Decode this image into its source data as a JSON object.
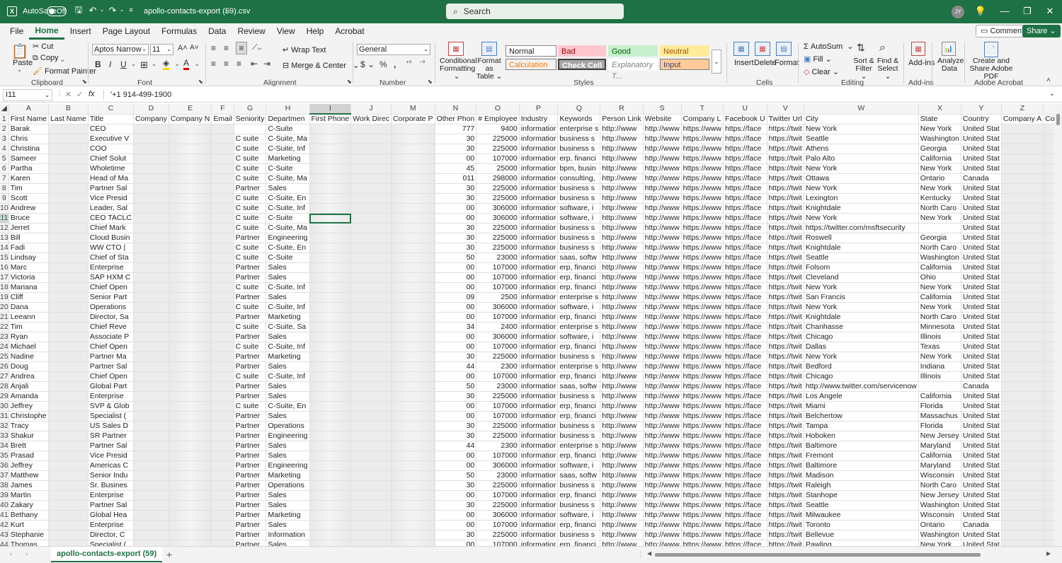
{
  "titlebar": {
    "autosave_label": "AutoSave",
    "autosave_state": "Off",
    "filename": "apollo-contacts-export (59).csv",
    "search_placeholder": "Search",
    "user_initials": "JY"
  },
  "menu": [
    "File",
    "Home",
    "Insert",
    "Page Layout",
    "Formulas",
    "Data",
    "Review",
    "View",
    "Help",
    "Acrobat"
  ],
  "menu_active": "Home",
  "menu_right": {
    "comments": "Comments",
    "share": "Share"
  },
  "ribbon": {
    "clipboard": {
      "paste": "Paste",
      "cut": "Cut",
      "copy": "Copy",
      "format_painter": "Format Painter",
      "group": "Clipboard"
    },
    "font": {
      "name": "Aptos Narrow",
      "size": "11",
      "group": "Font"
    },
    "alignment": {
      "wrap": "Wrap Text",
      "merge": "Merge & Center",
      "group": "Alignment"
    },
    "number": {
      "format": "General",
      "group": "Number"
    },
    "styles": {
      "conditional": "Conditional Formatting",
      "format_table": "Format as Table",
      "normal": "Normal",
      "bad": "Bad",
      "good": "Good",
      "neutral": "Neutral",
      "calculation": "Calculation",
      "check_cell": "Check Cell",
      "explanatory": "Explanatory T...",
      "input": "Input",
      "group": "Styles"
    },
    "cells": {
      "insert": "Insert",
      "delete": "Delete",
      "format": "Format",
      "group": "Cells"
    },
    "editing": {
      "autosum": "AutoSum",
      "fill": "Fill",
      "clear": "Clear",
      "sort": "Sort & Filter",
      "find": "Find & Select",
      "group": "Editing"
    },
    "addins": {
      "label": "Add-ins",
      "group": "Add-ins"
    },
    "analyze": {
      "label": "Analyze Data"
    },
    "acrobat": {
      "label": "Create and Share Adobe PDF",
      "group": "Adobe Acrobat"
    },
    "colors": {
      "normal": "#ffffff",
      "bad": "#ffc7ce",
      "good": "#c6efce",
      "neutral": "#ffeb9c",
      "calculation": "#f2f2f2",
      "check": "#a5a5a5",
      "input": "#ffcc99"
    }
  },
  "formula_bar": {
    "name_box": "I11",
    "fx": "fx",
    "value": "'+1 914-499-1900"
  },
  "columns": [
    "A",
    "B",
    "C",
    "D",
    "E",
    "F",
    "G",
    "H",
    "I",
    "J",
    "M",
    "N",
    "O",
    "P",
    "Q",
    "R",
    "S",
    "T",
    "U",
    "V",
    "W",
    "X",
    "Y",
    "Z",
    "AA",
    "AB",
    "AC",
    "AD",
    "AE",
    "AF",
    "AG"
  ],
  "headers": [
    "First Name",
    "Last Name",
    "Title",
    "Company",
    "Company N",
    "Email",
    "Seniority",
    "Departmen",
    "First Phone",
    "Work Direc",
    "Corporate P",
    "Other Phon",
    "# Employee",
    "Industry",
    "Keywords",
    "Person Link",
    "Website",
    "Company L",
    "Facebook U",
    "Twitter Url",
    "City",
    "State",
    "Country",
    "Company A",
    "Company C",
    "Company S",
    "Company C",
    "Company P",
    "SEO Descri",
    "Technologie",
    "Annual Rev"
  ],
  "rows": [
    [
      "Barak",
      "CEO",
      "",
      "777",
      "9400",
      "informatior",
      "enterprise s",
      "New York",
      "New York",
      "United Stat"
    ],
    [
      "Chris",
      "Executive V",
      "C suite",
      "30",
      "225000",
      "informatior",
      "business s",
      "Seattle",
      "Washington",
      "United Stat"
    ],
    [
      "Christina",
      "COO",
      "C suite",
      "30",
      "225000",
      "informatior",
      "business s",
      "Athens",
      "Georgia",
      "United Stat"
    ],
    [
      "Sameer",
      "Chief Solut",
      "C suite",
      "00",
      "107000",
      "informatior",
      "erp, financi",
      "Palo Alto",
      "California",
      "United Stat"
    ],
    [
      "Partha",
      "Wholetime",
      "C suite",
      "45",
      "25000",
      "informatior",
      "bpm, busin",
      "New York",
      "New York",
      "United Stat"
    ],
    [
      "Karen",
      "Head of Ma",
      "C suite",
      "011",
      "298000",
      "informatior",
      "consulting,",
      "Ottawa",
      "Ontario",
      "Canada"
    ],
    [
      "Tim",
      "Partner Sal",
      "Partner",
      "30",
      "225000",
      "informatior",
      "business s",
      "New York",
      "New York",
      "United Stat"
    ],
    [
      "Scott",
      "Vice Presid",
      "C suite",
      "30",
      "225000",
      "informatior",
      "business s",
      "Lexington",
      "Kentucky",
      "United Stat"
    ],
    [
      "Andrew",
      "Leader, Sal",
      "C suite",
      "00",
      "306000",
      "informatior",
      "software, i",
      "Knightdale",
      "North Caro",
      "United Stat"
    ],
    [
      "Bruce",
      "CEO TACLC",
      "C suite",
      "00",
      "306000",
      "informatior",
      "software, i",
      "New York",
      "New York",
      "United Stat"
    ],
    [
      "Jerret",
      "Chief Mark",
      "C suite",
      "30",
      "225000",
      "informatior",
      "business s",
      "https://twitter.com/msftsecurity",
      "",
      "United Stat"
    ],
    [
      "Bill",
      "Cloud Busin",
      "Partner",
      "30",
      "225000",
      "informatior",
      "business s",
      "Roswell",
      "Georgia",
      "United Stat"
    ],
    [
      "Fadi",
      "WW CTO |",
      "C suite",
      "30",
      "225000",
      "informatior",
      "business s",
      "Knightdale",
      "North Caro",
      "United Stat"
    ],
    [
      "Lindsay",
      "Chief of Sta",
      "C suite",
      "50",
      "23000",
      "informatior",
      "saas, softw",
      "Seattle",
      "Washington",
      "United Stat"
    ],
    [
      "Marc",
      "Enterprise",
      "Partner",
      "00",
      "107000",
      "informatior",
      "erp, financi",
      "Folsom",
      "California",
      "United Stat"
    ],
    [
      "Victoria",
      "SAP HXM C",
      "Partner",
      "00",
      "107000",
      "informatior",
      "erp, financi",
      "Cleveland",
      "Ohio",
      "United Stat"
    ],
    [
      "Mariana",
      "Chief Open",
      "C suite",
      "00",
      "107000",
      "informatior",
      "erp, financi",
      "New York",
      "New York",
      "United Stat"
    ],
    [
      "Cliff",
      "Senior Part",
      "Partner",
      "09",
      "2500",
      "informatior",
      "enterprise s",
      "San Francis",
      "California",
      "United Stat"
    ],
    [
      "Dana",
      "Operations",
      "C suite",
      "00",
      "306000",
      "informatior",
      "software, i",
      "New York",
      "New York",
      "United Stat"
    ],
    [
      "Leeann",
      "Director, Sa",
      "Partner",
      "00",
      "107000",
      "informatior",
      "erp, financi",
      "Knightdale",
      "North Caro",
      "United Stat"
    ],
    [
      "Tim",
      "Chief Reve",
      "C suite",
      "34",
      "2400",
      "informatior",
      "enterprise s",
      "Chanhasse",
      "Minnesota",
      "United Stat"
    ],
    [
      "Ryan",
      "Associate P",
      "Partner",
      "00",
      "306000",
      "informatior",
      "software, i",
      "Chicago",
      "Illinois",
      "United Stat"
    ],
    [
      "Michael",
      "Chief Open",
      "C suite",
      "00",
      "107000",
      "informatior",
      "erp, financi",
      "Dallas",
      "Texas",
      "United Stat"
    ],
    [
      "Nadine",
      "Partner Ma",
      "Partner",
      "30",
      "225000",
      "informatior",
      "business s",
      "New York",
      "New York",
      "United Stat"
    ],
    [
      "Doug",
      "Partner Sal",
      "Partner",
      "44",
      "2300",
      "informatior",
      "enterprise s",
      "Bedford",
      "Indiana",
      "United Stat"
    ],
    [
      "Andrea",
      "Chief Open",
      "C suite",
      "00",
      "107000",
      "informatior",
      "erp, financi",
      "Chicago",
      "Illinois",
      "United Stat"
    ],
    [
      "Anjali",
      "Global Part",
      "Partner",
      "50",
      "23000",
      "informatior",
      "saas, softw",
      "http://www.twitter.com/servicenow",
      "",
      "Canada"
    ],
    [
      "Amanda",
      "Enterprise",
      "Partner",
      "30",
      "225000",
      "informatior",
      "business s",
      "Los Angele",
      "California",
      "United Stat"
    ],
    [
      "Jeffrey",
      "SVP & Glob",
      "C suite",
      "00",
      "107000",
      "informatior",
      "erp, financi",
      "Miami",
      "Florida",
      "United Stat"
    ],
    [
      "Christophe",
      "Specialist (",
      "Partner",
      "00",
      "107000",
      "informatior",
      "erp, financi",
      "Belchertow",
      "Massachus",
      "United Stat"
    ],
    [
      "Tracy",
      "US Sales D",
      "Partner",
      "30",
      "225000",
      "informatior",
      "business s",
      "Tampa",
      "Florida",
      "United Stat"
    ],
    [
      "Shakur",
      "SR Partner",
      "Partner",
      "30",
      "225000",
      "informatior",
      "business s",
      "Hoboken",
      "New Jersey",
      "United Stat"
    ],
    [
      "Brett",
      "Partner Sal",
      "Partner",
      "44",
      "2300",
      "informatior",
      "enterprise s",
      "Baltimore",
      "Maryland",
      "United Stat"
    ],
    [
      "Prasad",
      "Vice Presid",
      "Partner",
      "00",
      "107000",
      "informatior",
      "erp, financi",
      "Fremont",
      "California",
      "United Stat"
    ],
    [
      "Jeffrey",
      "Americas C",
      "Partner",
      "00",
      "306000",
      "informatior",
      "software, i",
      "Baltimore",
      "Maryland",
      "United Stat"
    ],
    [
      "Matthew",
      "Senior Indu",
      "Partner",
      "50",
      "23000",
      "informatior",
      "saas, softw",
      "Madison",
      "Wisconsin",
      "United Stat"
    ],
    [
      "James",
      "Sr. Busines",
      "Partner",
      "30",
      "225000",
      "informatior",
      "business s",
      "Raleigh",
      "North Caro",
      "United Stat"
    ],
    [
      "Martin",
      "Enterprise",
      "Partner",
      "00",
      "107000",
      "informatior",
      "erp, financi",
      "Stanhope",
      "New Jersey",
      "United Stat"
    ],
    [
      "Zakary",
      "Partner Sal",
      "Partner",
      "30",
      "225000",
      "informatior",
      "business s",
      "Seattle",
      "Washington",
      "United Stat"
    ],
    [
      "Bethany",
      "Global Hea",
      "Partner",
      "00",
      "306000",
      "informatior",
      "software, i",
      "Milwaukee",
      "Wisconsin",
      "United Stat"
    ],
    [
      "Kurt",
      "Enterprise",
      "Partner",
      "00",
      "107000",
      "informatior",
      "erp, financi",
      "Toronto",
      "Ontario",
      "Canada"
    ],
    [
      "Stephanie",
      "Director, C",
      "Partner",
      "30",
      "225000",
      "informatior",
      "business s",
      "Bellevue",
      "Washington",
      "United Stat"
    ],
    [
      "Thomas",
      "Specialist (",
      "Partner",
      "00",
      "107000",
      "informatior",
      "erp, financi",
      "Pawling",
      "New York",
      "United Stat"
    ],
    [
      "Oliver",
      "Chief Comm",
      "C suite",
      "00",
      "107000",
      "informatior",
      "erp, financi",
      "San Francis",
      "California",
      "United Stat"
    ],
    [
      "David",
      "Customer S",
      "Partner",
      "00",
      "107000",
      "informatior",
      "erp, financi",
      "Stow",
      "Ohio",
      "United Stat"
    ]
  ],
  "departments": [
    "C-Suite",
    "C-Suite, Ma",
    "C-Suite, Inf",
    "Marketing",
    "C-Suite",
    "C-Suite, Ma",
    "Sales",
    "C-Suite, En",
    "C-Suite, Inf",
    "C-Suite",
    "C-Suite, Ma",
    "Engineering",
    "C-Suite, En",
    "C-Suite",
    "Sales",
    "Sales",
    "C-Suite, Inf",
    "Sales",
    "C-Suite, Inf",
    "Marketing",
    "C-Suite, Sa",
    "Sales",
    "C-Suite, Inf",
    "Marketing",
    "Sales",
    "C-Suite, Inf",
    "Sales",
    "Sales",
    "C-Suite, En",
    "Sales",
    "Operations",
    "Engineering",
    "Sales",
    "Sales",
    "Engineering",
    "Marketing",
    "Operations",
    "Sales",
    "Sales",
    "Marketing",
    "Sales",
    "Information",
    "Sales",
    "Marketing",
    "Engineering"
  ],
  "link_text": {
    "person": "http://www",
    "website": "http://www",
    "company": "https://www",
    "facebook": "https://face",
    "twitter": "https://twit"
  },
  "sheet_tab": "apollo-contacts-export (59)",
  "add_sheet": "+"
}
